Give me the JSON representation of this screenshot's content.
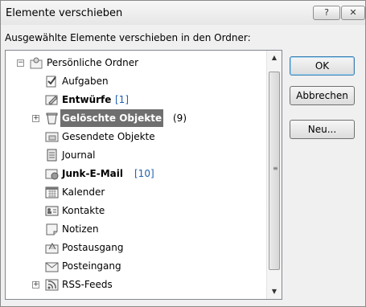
{
  "window": {
    "title": "Elemente verschieben",
    "help_label": "?",
    "close_label": "✕"
  },
  "prompt": "Ausgewählte Elemente verschieben in den Ordner:",
  "tree": {
    "root": {
      "label": "Persönliche Ordner",
      "expander": "−",
      "icon": "personal-folders-icon"
    },
    "items": [
      {
        "label": "Aufgaben",
        "count": "",
        "bold": false,
        "icon": "tasks-icon"
      },
      {
        "label": "Entwürfe",
        "count": "[1]",
        "bold": true,
        "icon": "drafts-icon"
      },
      {
        "label": "Gelöschte Objekte",
        "count": "(9)",
        "bold": true,
        "selected": true,
        "expander": "+",
        "icon": "deleted-items-icon"
      },
      {
        "label": "Gesendete Objekte",
        "count": "",
        "bold": false,
        "icon": "sent-items-icon"
      },
      {
        "label": "Journal",
        "count": "",
        "bold": false,
        "icon": "journal-icon"
      },
      {
        "label": "Junk-E-Mail",
        "count": "[10]",
        "bold": true,
        "icon": "junk-mail-icon"
      },
      {
        "label": "Kalender",
        "count": "",
        "bold": false,
        "icon": "calendar-icon"
      },
      {
        "label": "Kontakte",
        "count": "",
        "bold": false,
        "icon": "contacts-icon"
      },
      {
        "label": "Notizen",
        "count": "",
        "bold": false,
        "icon": "notes-icon"
      },
      {
        "label": "Postausgang",
        "count": "",
        "bold": false,
        "icon": "outbox-icon"
      },
      {
        "label": "Posteingang",
        "count": "",
        "bold": false,
        "icon": "inbox-icon"
      },
      {
        "label": "RSS-Feeds",
        "count": "",
        "bold": false,
        "expander": "+",
        "icon": "rss-icon"
      }
    ]
  },
  "scrollbar": {
    "up": "▲",
    "down": "▼",
    "grip": "≡"
  },
  "buttons": {
    "ok": "OK",
    "cancel": "Abbrechen",
    "new": "Neu..."
  },
  "colors": {
    "selection": "#6f6f6f",
    "count_blue": "#1f5fb0"
  }
}
